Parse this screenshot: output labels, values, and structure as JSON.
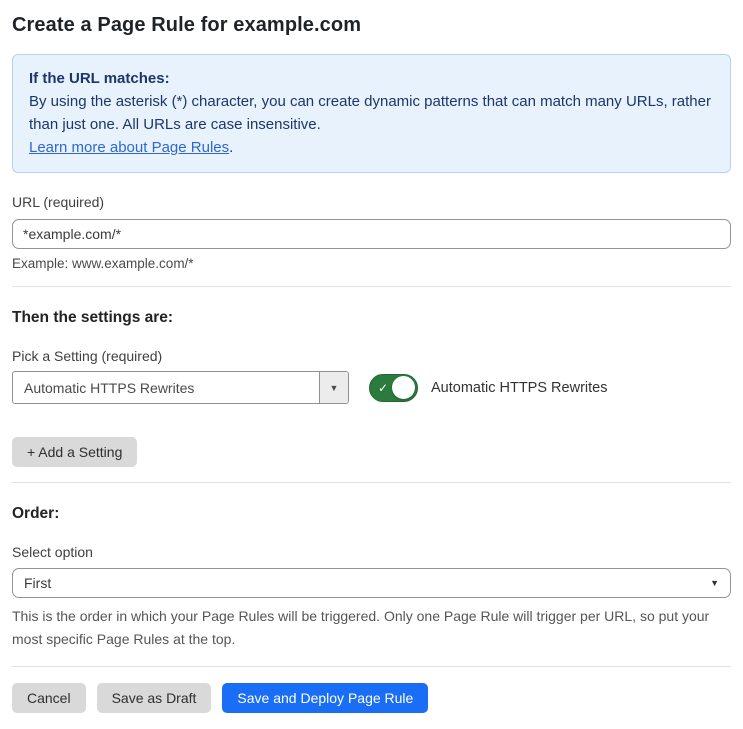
{
  "page": {
    "title": "Create a Page Rule for example.com"
  },
  "info_box": {
    "heading": "If the URL matches:",
    "body": "By using the asterisk (*) character, you can create dynamic patterns that can match many URLs, rather than just one. All URLs are case insensitive.",
    "link_label": "Learn more about Page Rules",
    "link_suffix": "."
  },
  "url_field": {
    "label": "URL (required)",
    "value": "*example.com/*",
    "hint": "Example: www.example.com/*"
  },
  "settings_section": {
    "heading": "Then the settings are:",
    "pick_label": "Pick a Setting (required)",
    "selected_setting": "Automatic HTTPS Rewrites",
    "dropdown_arrow": "▼",
    "toggle_state": "on",
    "toggle_check": "✓",
    "toggle_label": "Automatic HTTPS Rewrites",
    "add_button_label": "+ Add a Setting"
  },
  "order_section": {
    "heading": "Order:",
    "select_label": "Select option",
    "selected_option": "First",
    "select_arrow": "▼",
    "description": "This is the order in which your Page Rules will be triggered. Only one Page Rule will trigger per URL, so put your most specific Page Rules at the top."
  },
  "actions": {
    "cancel_label": "Cancel",
    "save_draft_label": "Save as Draft",
    "save_deploy_label": "Save and Deploy Page Rule"
  },
  "colors": {
    "info_bg": "#e8f2fc",
    "info_border": "#b5d3ef",
    "info_text": "#1c366b",
    "link_blue": "#2e67d3",
    "toggle_green": "#2b7b3f",
    "primary_blue": "#1a6ef5",
    "button_gray": "#d9d9d9"
  }
}
